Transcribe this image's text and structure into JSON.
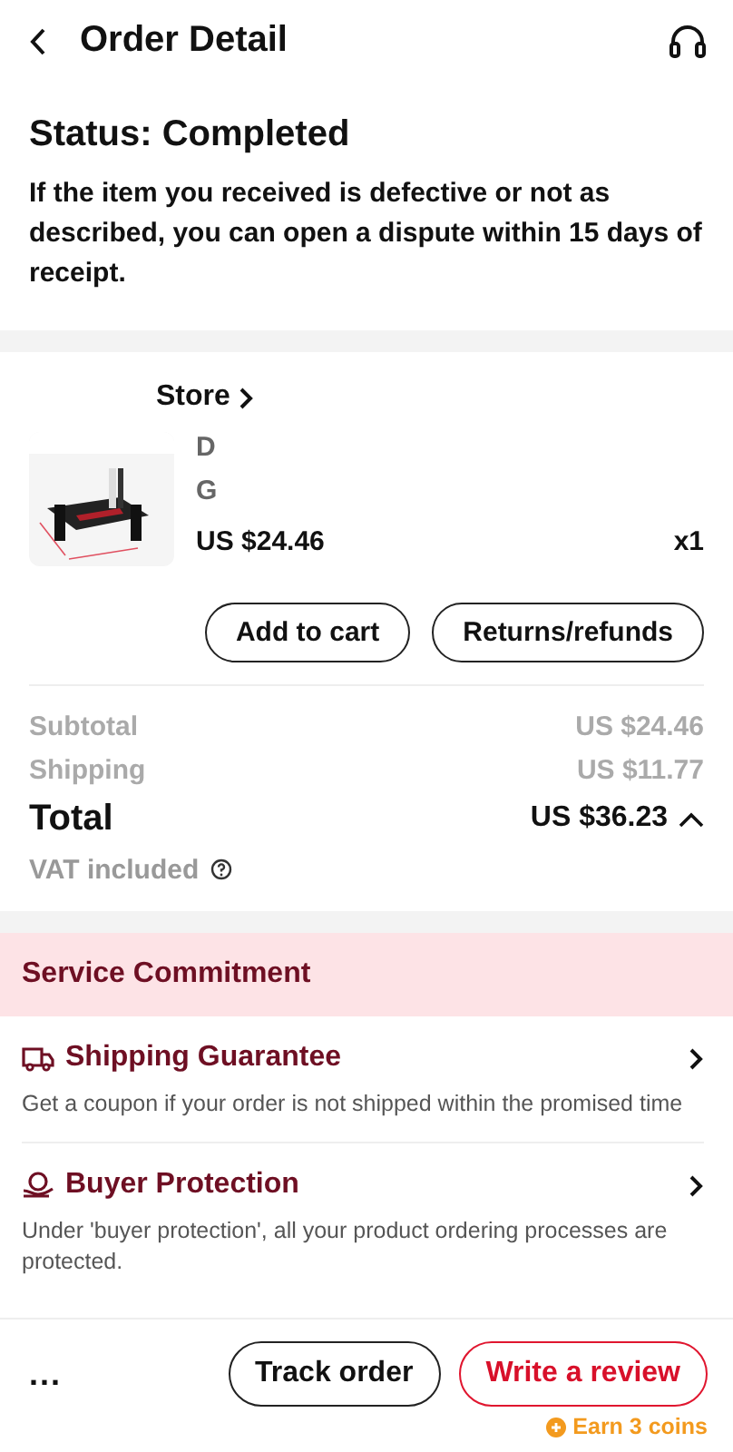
{
  "header": {
    "title": "Order Detail"
  },
  "status": {
    "title": "Status: Completed",
    "message": "If the item you received is defective or not as described, you can open a dispute within 15 days of receipt."
  },
  "store": {
    "name": "Store"
  },
  "product": {
    "title_lines": [
      "D",
      "G"
    ],
    "price": "US $24.46",
    "quantity": "x1"
  },
  "product_actions": [
    "Add to cart",
    "Returns/refunds"
  ],
  "summary": [
    {
      "label": "Subtotal",
      "value": "US $24.46"
    },
    {
      "label": "Shipping",
      "value": "US $11.77"
    }
  ],
  "total": {
    "label": "Total",
    "value": "US $36.23",
    "expanded": true
  },
  "vat": "VAT included",
  "service": {
    "title": "Service Commitment",
    "items": [
      {
        "kind": "shipping",
        "title": "Shipping Guarantee",
        "description": "Get a coupon if your order is not shipped within the promised time"
      },
      {
        "kind": "protection",
        "title": "Buyer Protection",
        "description": "Under 'buyer protection', all your product ordering processes are protected."
      }
    ]
  },
  "bottom_bar": {
    "more": "...",
    "buttons": [
      {
        "label": "Track order",
        "kind": "outline"
      },
      {
        "label": "Write a review",
        "kind": "primary"
      }
    ],
    "reward": "Earn 3 coins"
  }
}
